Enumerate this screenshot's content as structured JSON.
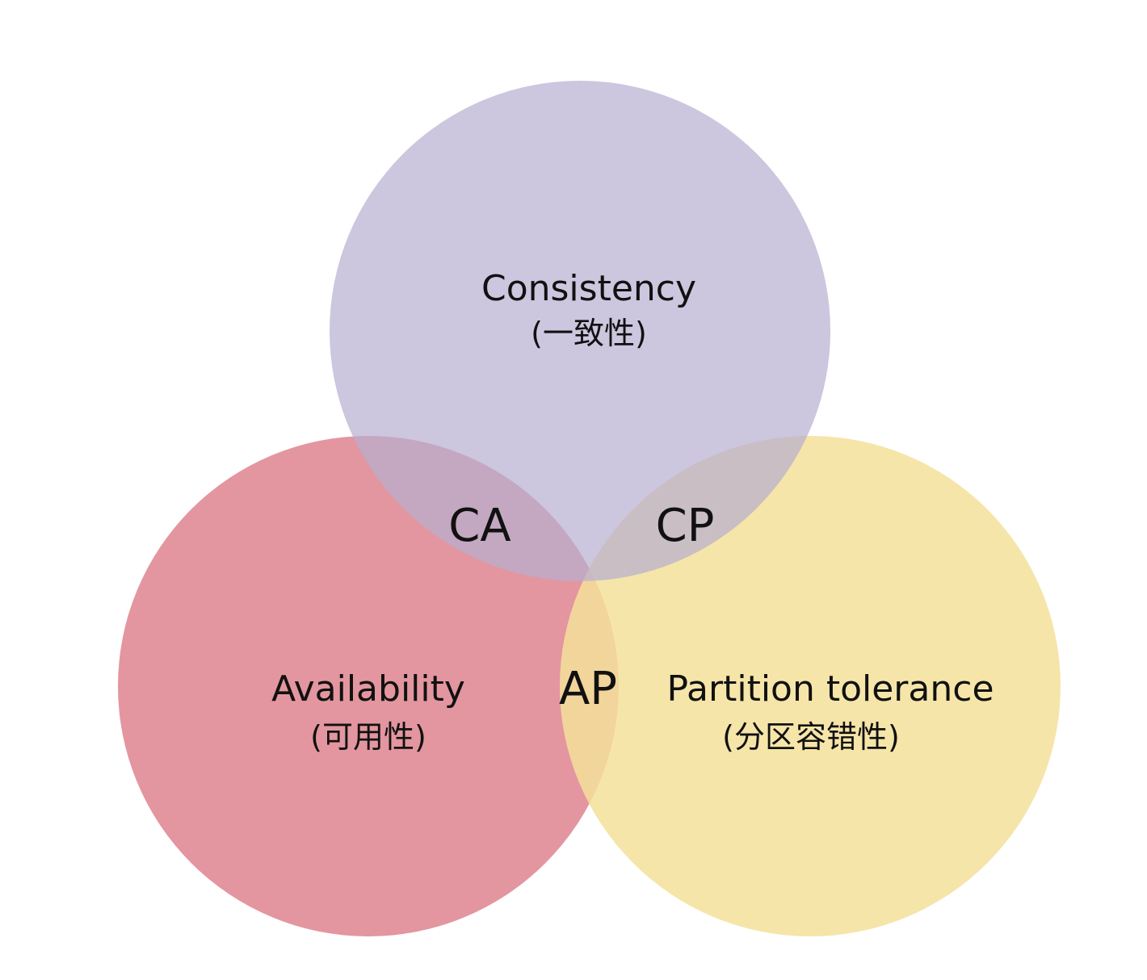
{
  "sets": [
    {
      "id": "consistency",
      "name": "Consistency",
      "subtitle": "(一致性)",
      "color": "#b7aed0"
    },
    {
      "id": "availability",
      "name": "Availability",
      "subtitle": "(可用性)",
      "color": "#d9737f"
    },
    {
      "id": "partition",
      "name": "Partition tolerance",
      "subtitle": "(分区容错性)",
      "color": "#f5e09a"
    }
  ],
  "intersections": [
    {
      "id": "ca",
      "label": "CA",
      "sets": [
        "consistency",
        "availability"
      ]
    },
    {
      "id": "cp",
      "label": "CP",
      "sets": [
        "consistency",
        "partition"
      ]
    },
    {
      "id": "ap",
      "label": "AP",
      "sets": [
        "availability",
        "partition"
      ]
    }
  ]
}
